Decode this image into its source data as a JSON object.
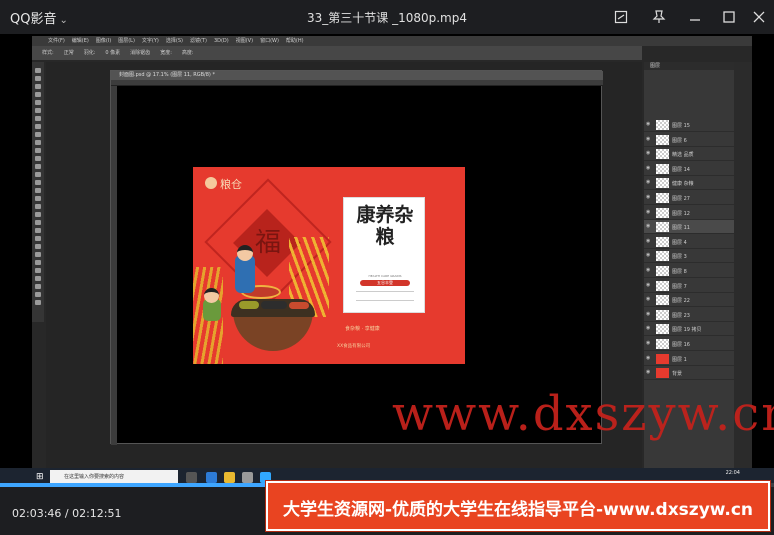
{
  "player": {
    "app_name": "QQ影音",
    "video_title": "33_第三十节课 _1080p.mp4",
    "current_time": "02:03:46",
    "total_time": "02:12:51",
    "time_display": "02:03:46 / 02:12:51",
    "progress": 0.932
  },
  "photoshop": {
    "menu": [
      "文件(F)",
      "编辑(E)",
      "图像(I)",
      "图层(L)",
      "文字(Y)",
      "选择(S)",
      "滤镜(T)",
      "3D(D)",
      "视图(V)",
      "窗口(W)",
      "帮助(H)"
    ],
    "options": [
      "样式:",
      "正常",
      "羽化:",
      "0 像素",
      "消除锯齿",
      "宽度:",
      "高度:"
    ],
    "doc_tab": "封面图.psd @ 17.1% (图层 11, RGB/8) *",
    "layers_title": "图层",
    "layers": [
      {
        "name": "图层 15"
      },
      {
        "name": "图层 6"
      },
      {
        "name": "精选 品质"
      },
      {
        "name": "图层 14"
      },
      {
        "name": "健康 杂粮"
      },
      {
        "name": "图层 27"
      },
      {
        "name": "图层 12"
      },
      {
        "name": "图层 11"
      },
      {
        "name": "图层 4"
      },
      {
        "name": "图层 3"
      },
      {
        "name": "图层 8"
      },
      {
        "name": "图层 7"
      },
      {
        "name": "图层 22"
      },
      {
        "name": "图层 23"
      },
      {
        "name": "图层 19 拷贝"
      },
      {
        "name": "图层 16"
      },
      {
        "name": "图层 1"
      },
      {
        "name": "背景"
      }
    ]
  },
  "artwork": {
    "logo": "粮仓",
    "fu": "福",
    "card_title": "康养杂粮",
    "card_subtitle": "HEALTH CARE GRAINS",
    "card_tag": "五谷丰登",
    "tagline": "食杂粮 · 享健康",
    "company": "XX食品有限公司"
  },
  "taskbar": {
    "search_placeholder": "在这里输入你要搜索的内容",
    "clock": "22:04"
  },
  "watermark": {
    "url_text": "www.dxszyw.cn",
    "banner": "大学生资源网-优质的大学生在线指导平台-www.dxszyw.cn"
  },
  "colors": {
    "accent": "#3ea6ff",
    "banner_bg": "#e94421",
    "art_bg": "#e63a2e"
  }
}
